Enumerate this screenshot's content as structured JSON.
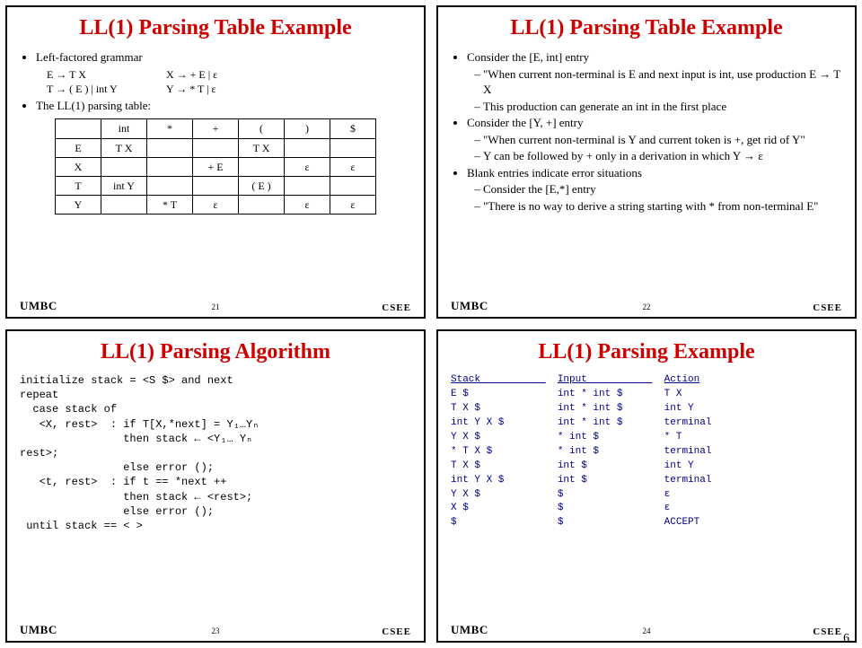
{
  "page_number": "6",
  "footer": {
    "left": "UMBC",
    "right": "CSEE"
  },
  "slides": [
    {
      "num": "21",
      "title": "LL(1) Parsing Table Example",
      "bullets": [
        "Left-factored grammar"
      ],
      "grammar": [
        [
          "E → T X",
          "X → + E | ε"
        ],
        [
          "T → ( E ) | int Y",
          "Y → * T | ε"
        ]
      ],
      "bullets2": [
        "The LL(1) parsing table:"
      ],
      "table": {
        "cols": [
          "",
          "int",
          "*",
          "+",
          "(",
          ")",
          "$"
        ],
        "rows": [
          [
            "E",
            "T X",
            "",
            "",
            "T X",
            "",
            ""
          ],
          [
            "X",
            "",
            "",
            "+ E",
            "",
            "ε",
            "ε"
          ],
          [
            "T",
            "int Y",
            "",
            "",
            "( E )",
            "",
            ""
          ],
          [
            "Y",
            "",
            "* T",
            "ε",
            "",
            "ε",
            "ε"
          ]
        ]
      }
    },
    {
      "num": "22",
      "title": "LL(1) Parsing Table Example",
      "points": [
        {
          "t": "Consider the [E, int] entry",
          "sub": [
            "\"When current non-terminal is E and next input is int, use production E → T X",
            "This production can generate an int in the first place"
          ]
        },
        {
          "t": "Consider the [Y, +] entry",
          "sub": [
            "\"When current non-terminal is Y and current token is +, get rid of Y\"",
            "Y can be followed by + only in a derivation in which Y → ε"
          ]
        },
        {
          "t": "Blank entries indicate error situations",
          "sub": [
            "Consider the [E,*] entry",
            "\"There is no way to derive a string starting with * from non-terminal E\""
          ]
        }
      ]
    },
    {
      "num": "23",
      "title": "LL(1) Parsing Algorithm",
      "code": "initialize stack = <S $> and next\nrepeat\n  case stack of\n   <X, rest>  : if T[X,*next] = Y₁…Yₙ\n                then stack ← <Y₁… Yₙ\nrest>;\n                else error ();\n   <t, rest>  : if t == *next ++\n                then stack ← <rest>;\n                else error ();\n until stack == < >"
    },
    {
      "num": "24",
      "title": "LL(1) Parsing Example",
      "traceHead": [
        "Stack",
        "Input",
        "Action"
      ],
      "trace": [
        [
          "E $",
          "int * int $",
          "T X"
        ],
        [
          "T X $",
          "int * int $",
          "int Y"
        ],
        [
          "int Y X $",
          "int * int $",
          "terminal"
        ],
        [
          "Y X $",
          "* int $",
          "* T"
        ],
        [
          "* T X $",
          "* int $",
          "terminal"
        ],
        [
          "T X $",
          "int $",
          "int Y"
        ],
        [
          "int Y X $",
          "int $",
          "terminal"
        ],
        [
          "Y X $",
          "$",
          "ε"
        ],
        [
          "X $",
          "$",
          "ε"
        ],
        [
          "$",
          "$",
          "ACCEPT"
        ]
      ]
    }
  ]
}
